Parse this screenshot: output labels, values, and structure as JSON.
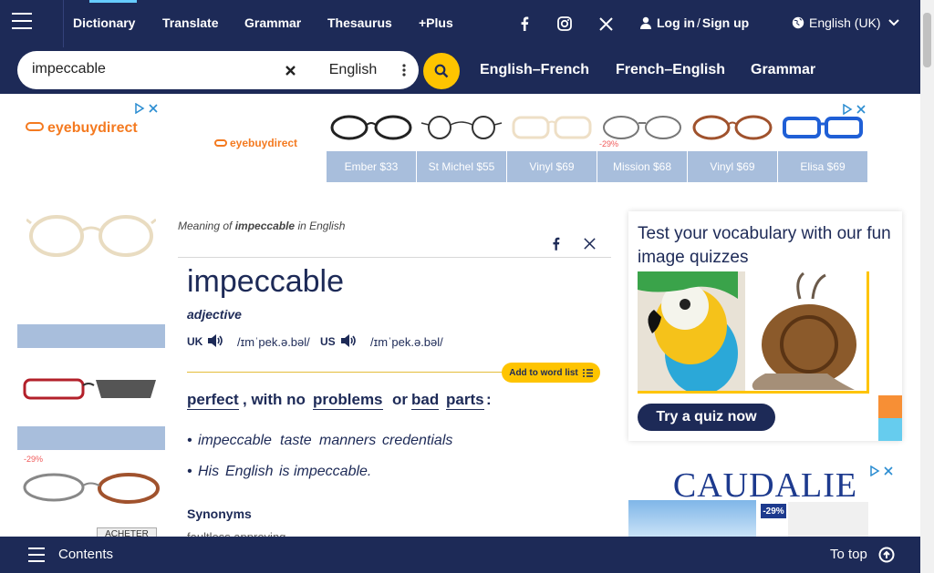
{
  "topnav": {
    "items": [
      "Dictionary",
      "Translate",
      "Grammar",
      "Thesaurus",
      "+Plus"
    ],
    "social": [
      "facebook-icon",
      "instagram-icon",
      "x-icon"
    ],
    "login": "Log in",
    "separator": "/",
    "signup": "Sign up",
    "language": "English (UK)"
  },
  "search": {
    "value": "impeccable",
    "dictionary": "English"
  },
  "quicklinks": [
    "English–French",
    "French–English",
    "Grammar"
  ],
  "ad_left": {
    "brand": "eyebuydirect",
    "discount": "-29%",
    "cta": "ACHETER"
  },
  "ad_top": {
    "brand": "eyebuydirect",
    "discount": "-29%",
    "products": [
      "Ember $33",
      "St Michel $55",
      "Vinyl $69",
      "Mission $68",
      "Vinyl $69",
      "Elisa $69"
    ]
  },
  "entry": {
    "meaning_prefix": "Meaning of",
    "meaning_word": "impeccable",
    "meaning_suffix": "in English",
    "headword": "impeccable",
    "pos": "adjective",
    "uk_label": "UK",
    "uk_ipa": "/ɪmˈpek.ə.bəl/",
    "us_label": "US",
    "us_ipa": "/ɪmˈpek.ə.bəl/",
    "wordlist_label": "Add to word list",
    "definition": {
      "perfect": "perfect",
      "with_no": ", with no",
      "problems": "problems",
      "or": "or",
      "bad": "bad",
      "parts": "parts",
      "colon": ":"
    },
    "example1": {
      "lead": "impeccable",
      "w1": "taste",
      "w2": "manners",
      "w3": "credentials"
    },
    "example2": {
      "lead": "His",
      "w1": "English",
      "tail": "is impeccable."
    },
    "synonyms_heading": "Synonyms",
    "synonyms": "faultless  approving"
  },
  "quiz": {
    "title": "Test your vocabulary with our fun image quizzes",
    "button": "Try a quiz now"
  },
  "ad_right": {
    "brand": "CAUDALIE",
    "discount": "-29%"
  },
  "bottombar": {
    "contents": "Contents",
    "totop": "To top"
  },
  "colors": {
    "navy": "#1d2a57",
    "yellow": "#fec400",
    "orange_brand": "#f47a20"
  }
}
